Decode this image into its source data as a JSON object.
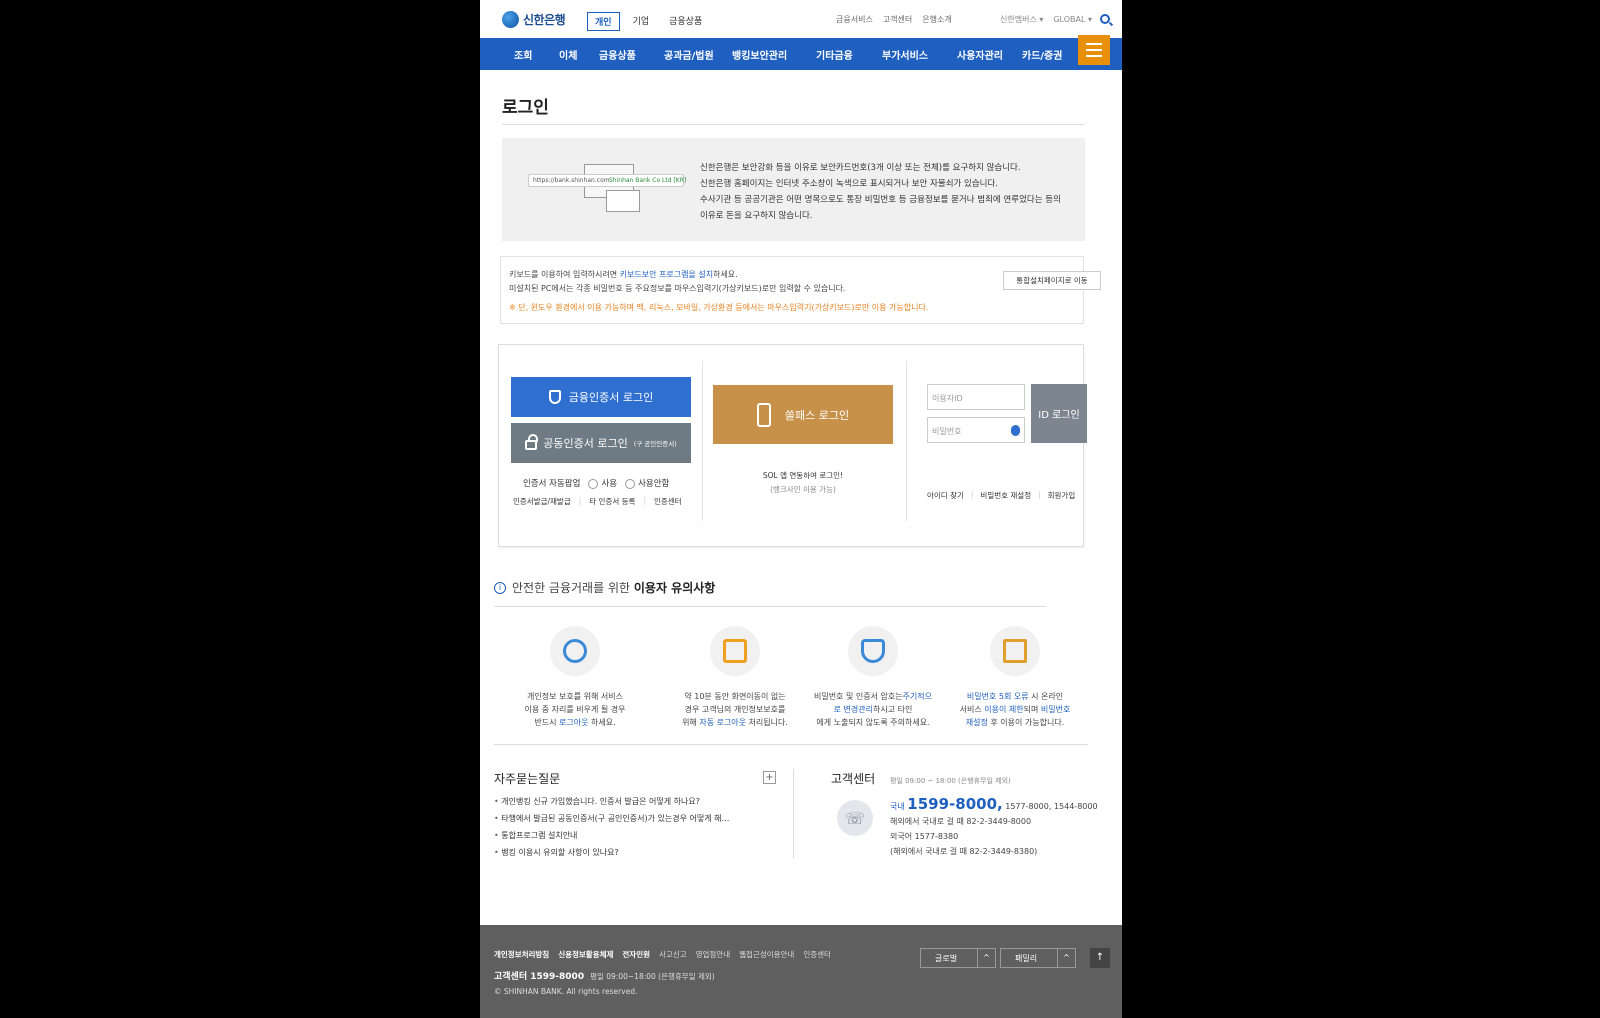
{
  "header": {
    "logo_text": "신한은행",
    "segments": [
      "개인",
      "기업",
      "금융상품"
    ],
    "util_links": [
      "금융서비스",
      "고객센터",
      "은행소개"
    ],
    "family_select": "신한멤버스 ▾",
    "global_select": "GLOBAL ▾"
  },
  "gnb": [
    "조회",
    "이체",
    "금융상품",
    "공과금/법원",
    "뱅킹보안관리",
    "기타금융",
    "부가서비스",
    "사용자관리",
    "카드/증권"
  ],
  "page_title": "로그인",
  "notice": {
    "url_text": "https://bank.shinhan.com",
    "cert_text": "Shinhan Bank Co Ltd [KR]",
    "lines": [
      "신한은행은 보안강화 등을 이유로 보안카드번호(3개 이상 또는 전체)를 요구하지 않습니다.",
      "신한은행 홈페이지는 인터넷 주소창이 녹색으로 표시되거나 보안 자물쇠가 있습니다.",
      "수사기관 등 공공기관은 어떤 명목으로도 통장 비밀번호 등 금융정보를 묻거나 범죄에 연루었다는 등의",
      "이유로 돈을 요구하지 않습니다."
    ]
  },
  "keyboard": {
    "line1_a": "키보드를 이용하여 입력하시려면 ",
    "line1_link": "키보드보안 프로그램을 설치",
    "line1_b": "하세요.",
    "line2": "미설치된 PC에서는 각종 비밀번호 등 주요정보를 마우스입력기(가상키보드)로만 입력할 수 있습니다.",
    "warning": "※ 단, 윈도우 환경에서 이용 가능하며 맥, 리눅스, 모바일, 가상환경 등에서는 마우스입력기(가상키보드)로만 이용 가능합니다.",
    "install_button": "통합설치페이지로 이동"
  },
  "login": {
    "cert_button": "금융인증서 로그인",
    "pub_button": "공동인증서 로그인",
    "pub_button_sub": "(구 공인인증서)",
    "auto_popup_label": "인증서 자동팝업",
    "radio_use": "사용",
    "radio_nouse": "사용안함",
    "cert_links": [
      "인증서발급/재발급",
      "타 인증서 등록",
      "인증센터"
    ],
    "sol_button": "쏠패스 로그인",
    "sol_text": "SOL 앱 연동하여 로그인!",
    "sol_sub": "(뱅크사인 이용 가능)",
    "id_placeholder": "이용자ID",
    "pw_placeholder": "비밀번호",
    "id_login_button": "ID 로그인",
    "id_links": [
      "아이디 찾기",
      "비밀번호 재설정",
      "회원가입"
    ]
  },
  "tips": {
    "title_a": "안전한 금융거래를 위한 ",
    "title_b": "이용자 유의사항",
    "items": [
      {
        "l1": "개인정보 보호를 위해 서비스",
        "l2": "이용 중 자리를 비우게 될 경우",
        "l3a": "반드시 ",
        "l3h": "로그아웃",
        "l3b": " 하세요."
      },
      {
        "l1": "약 10분 동안 화면이동이 없는",
        "l2": "경우 고객님의 개인정보보호를",
        "l3a": "위해 ",
        "l3h": "자동 로그아웃",
        "l3b": " 처리됩니다."
      },
      {
        "l1a": "비밀번호 및 인증서 암호는",
        "l1h": "주기적으",
        "l2h": "로 변경관리",
        "l2b": "하시고 타인",
        "l3": "에게 노출되지 않도록 주의하세요."
      },
      {
        "l1h": "비밀번호 5회 오류",
        "l1b": " 시 온라인",
        "l2a": "서비스 ",
        "l2h": "이용이 제한",
        "l2b": "되며 ",
        "l2h2": "비밀번호",
        "l3h": "재설정",
        "l3b": " 후 이용이 가능합니다."
      }
    ]
  },
  "faq": {
    "title": "자주묻는질문",
    "items": [
      "개인뱅킹 신규 가입했습니다. 인증서 발급은 어떻게 하나요?",
      "타행에서 발급된 공동인증서(구 공인인증서)가 있는경우 어떻게 해…",
      "통합프로그램 설치안내",
      "뱅킹 이용시 유의할 사항이 있나요?"
    ]
  },
  "cs": {
    "title": "고객센터",
    "hours": "평일 09:00 ~ 18:00 (은행휴무일 제외)",
    "domestic_label": "국내",
    "main_number": "1599-8000,",
    "other_numbers": "1577-8000, 1544-8000",
    "overseas_call": "해외에서 국내로 걸 때  82-2-3449-8000",
    "foreign": "외국어 1577-8380",
    "foreign_overseas": "(해외에서 국내로 걸 때 82-2-3449-8380)"
  },
  "footer": {
    "links_bold": [
      "개인정보처리방침",
      "신용정보활용체제",
      "전자민원"
    ],
    "links": [
      "사고신고",
      "영업점안내",
      "웹접근성이용안내",
      "인증센터"
    ],
    "cs_label": "고객센터 1599-8000",
    "cs_hours": "평일 09:00~18:00 (은행휴무일 제외)",
    "copyright": "© SHINHAN BANK. All rights reserved.",
    "select_global": "글로벌",
    "select_family": "패밀리"
  },
  "colors": {
    "primary": "#1f5fbf",
    "menu": "#e8900c",
    "sol": "#c8914a",
    "footer": "#5f5f5f"
  }
}
